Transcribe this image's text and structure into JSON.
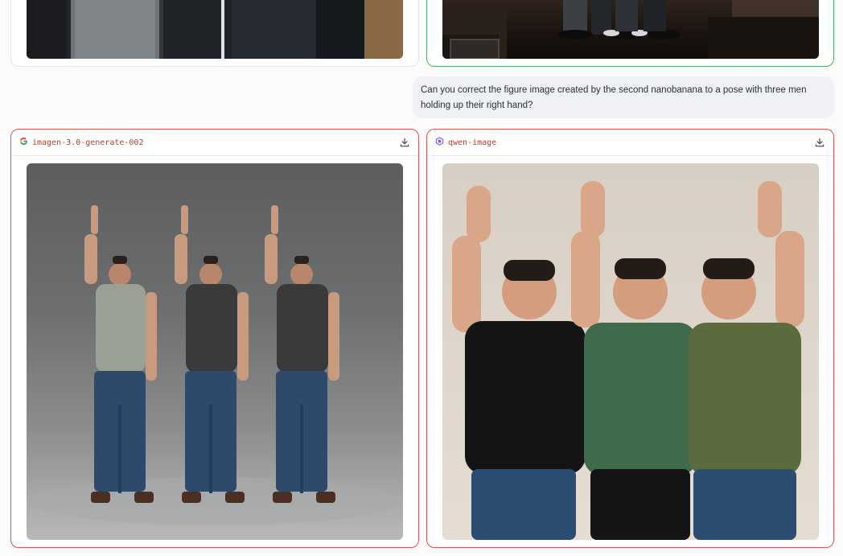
{
  "message": {
    "text": "Can you correct the figure image created by the second nanobanana to a pose with three men holding up their right hand?"
  },
  "responses": [
    {
      "model": "imagen-3.0-generate-002",
      "icon": "google-icon",
      "download_icon": "download-icon",
      "status_color": "#d9534f"
    },
    {
      "model": "qwen-image",
      "icon": "qwen-icon",
      "download_icon": "download-icon",
      "status_color": "#d9534f"
    }
  ],
  "previous": {
    "selected_color": "#4caf6a"
  }
}
